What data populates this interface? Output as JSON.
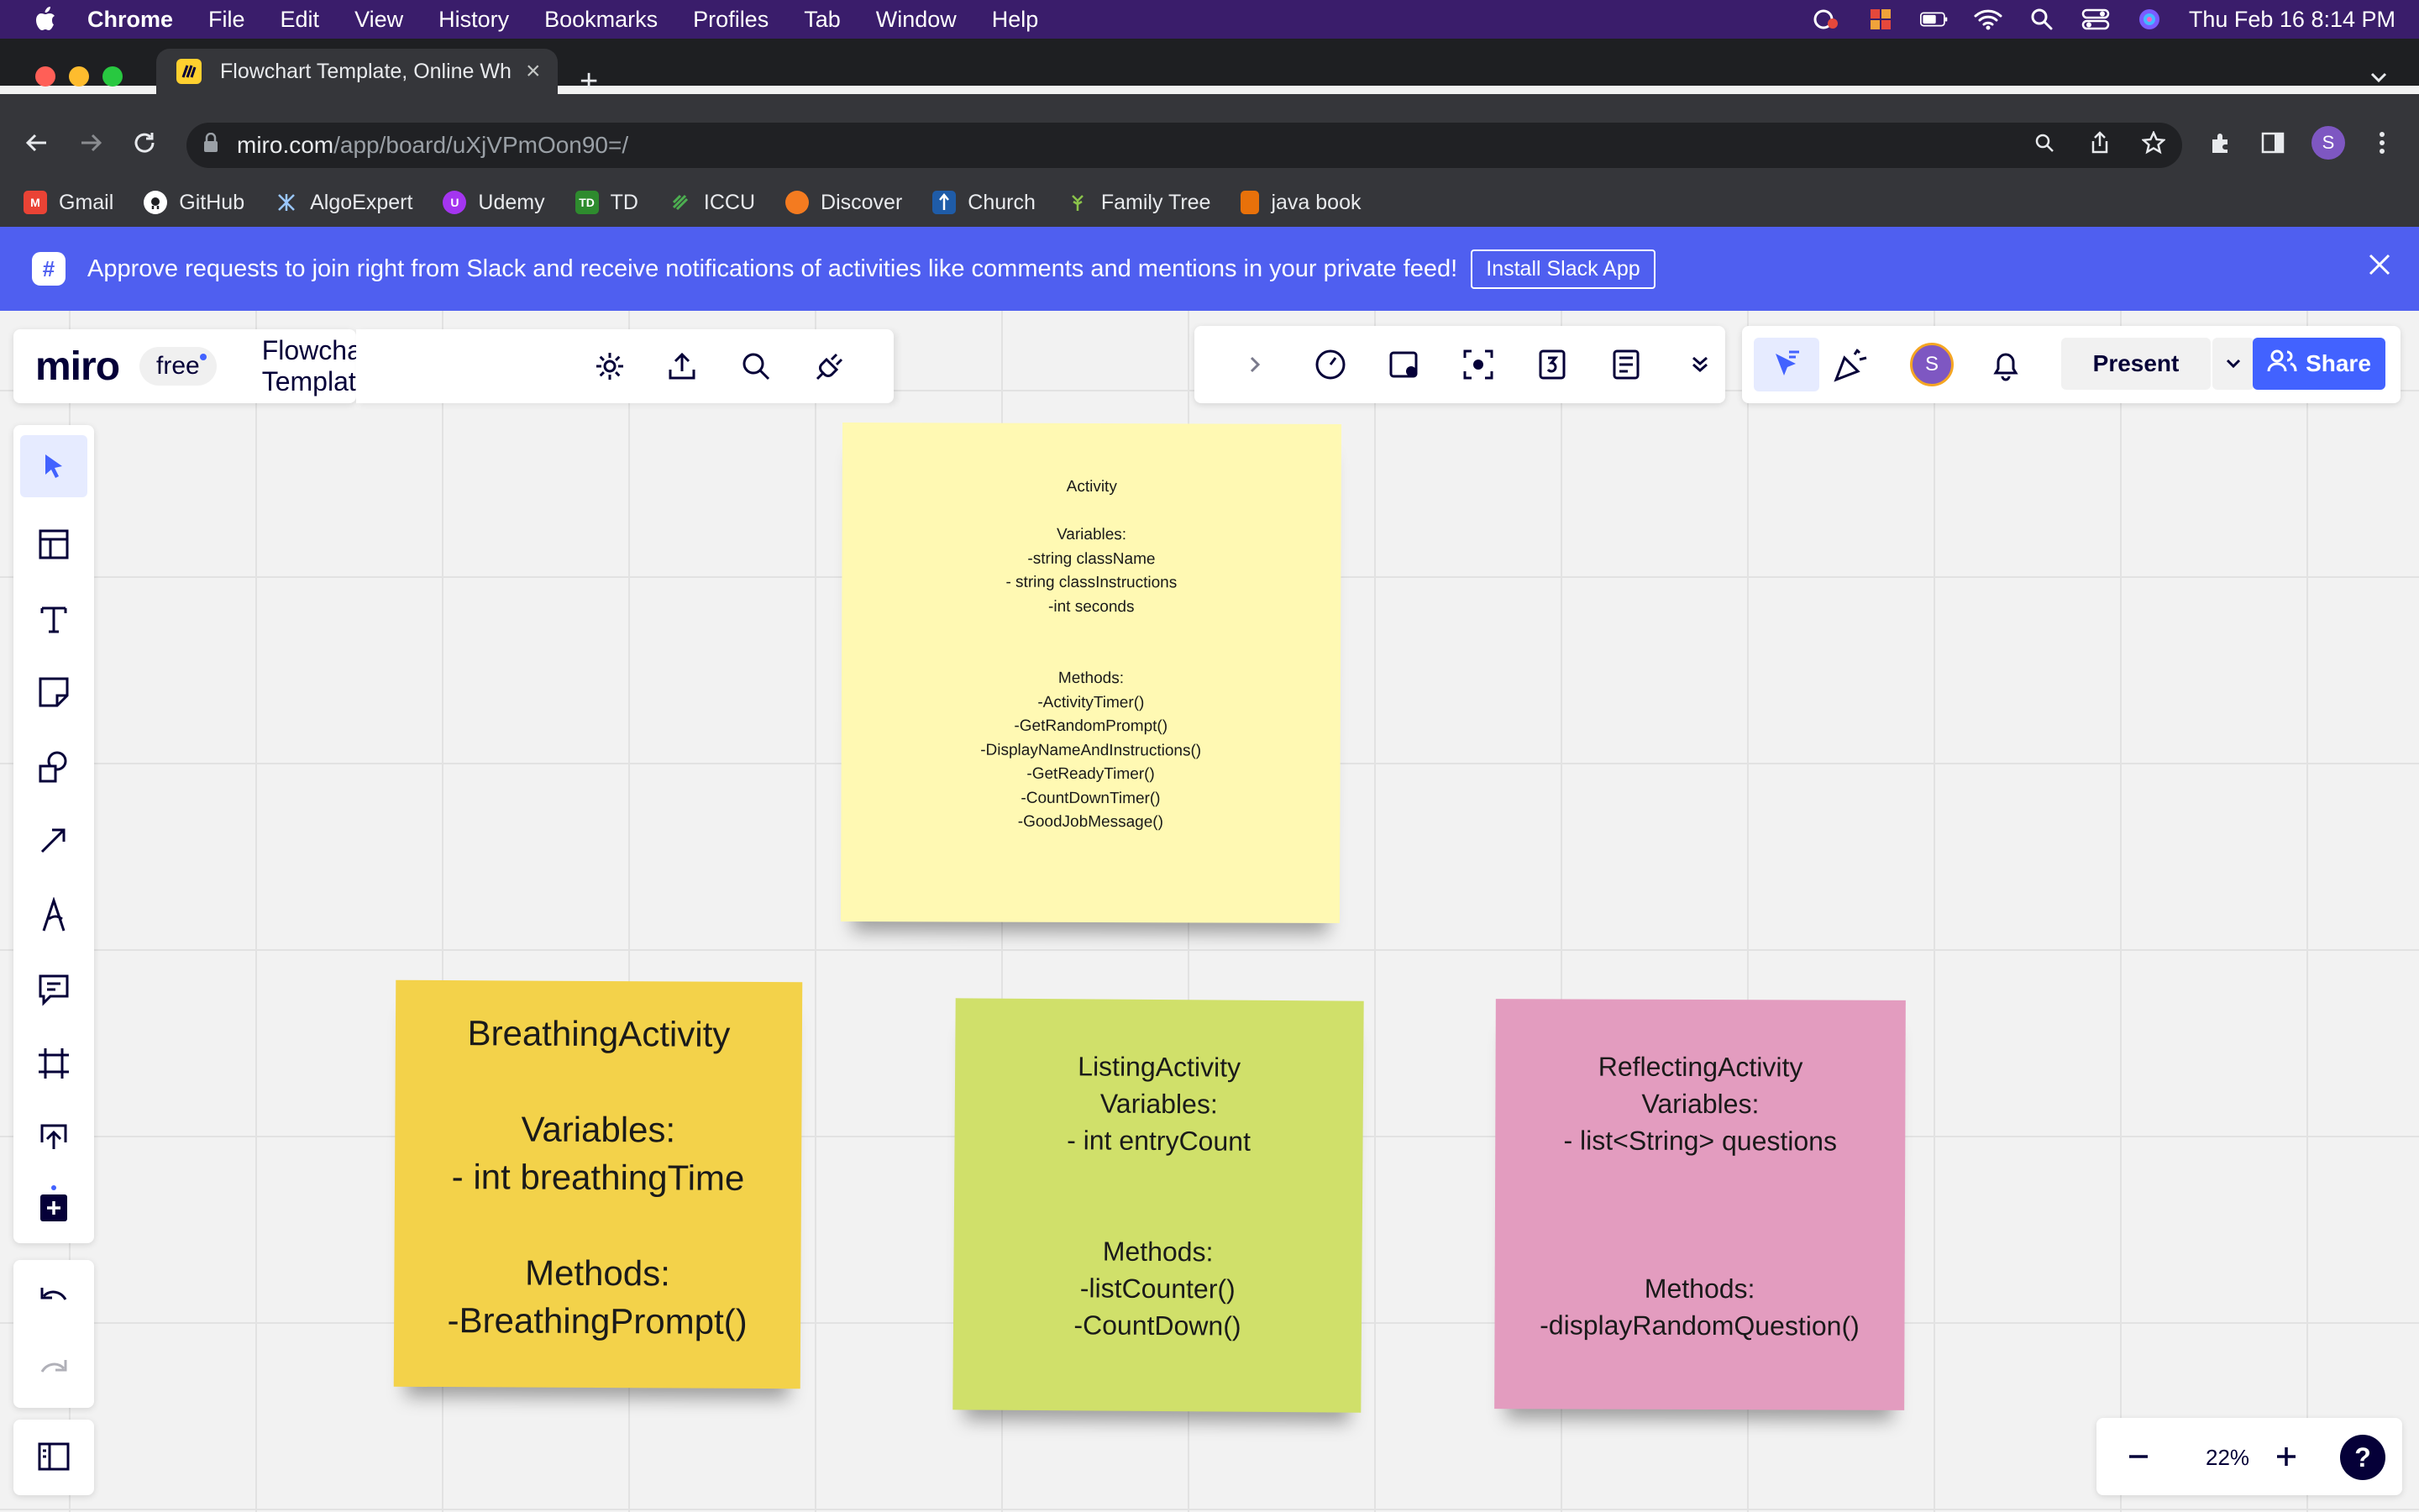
{
  "menubar": {
    "app": "Chrome",
    "items": [
      "File",
      "Edit",
      "View",
      "History",
      "Bookmarks",
      "Profiles",
      "Tab",
      "Window",
      "Help"
    ],
    "datetime": "Thu Feb 16  8:14 PM"
  },
  "browser": {
    "tab_title": "Flowchart Template, Online Wh",
    "url_host": "miro.com",
    "url_path": "/app/board/uXjVPmOon90=/",
    "profile_initial": "S"
  },
  "bookmarks": [
    {
      "label": "Gmail",
      "color": "#ea4335",
      "glyph": "M"
    },
    {
      "label": "GitHub",
      "color": "#ffffff",
      "glyph": ""
    },
    {
      "label": "AlgoExpert",
      "color": "#35363a",
      "glyph": ""
    },
    {
      "label": "Udemy",
      "color": "#a435f0",
      "glyph": "U"
    },
    {
      "label": "TD",
      "color": "#2e8b2e",
      "glyph": "TD"
    },
    {
      "label": "ICCU",
      "color": "#35363a",
      "glyph": ""
    },
    {
      "label": "Discover",
      "color": "#f47b20",
      "glyph": ""
    },
    {
      "label": "Church",
      "color": "#1f5ca8",
      "glyph": ""
    },
    {
      "label": "Family Tree",
      "color": "#35363a",
      "glyph": ""
    },
    {
      "label": "java book",
      "color": "#e8710a",
      "glyph": ""
    }
  ],
  "banner": {
    "text": "Approve requests to join right from Slack and receive notifications of activities like comments and mentions in your private feed!",
    "button": "Install Slack App"
  },
  "miro": {
    "logo": "miro",
    "plan": "free",
    "board_name": "Flowchart Template",
    "present_label": "Present",
    "share_label": "Share",
    "avatar_initial": "S",
    "zoom": "22%",
    "help": "?"
  },
  "notes": {
    "activity": "Activity\n\nVariables:\n-string className\n- string classInstructions\n-int seconds\n\n\nMethods:\n-ActivityTimer()\n-GetRandomPrompt()\n-DisplayNameAndInstructions()\n-GetReadyTimer()\n-CountDownTimer()\n-GoodJobMessage()",
    "breathing": "BreathingActivity\n\nVariables:\n- int breathingTime\n\nMethods:\n-BreathingPrompt()",
    "listing": "ListingActivity\nVariables:\n- int entryCount\n\n\nMethods:\n-listCounter()\n-CountDown()",
    "reflecting": "ReflectingActivity\nVariables:\n- list<String> questions\n\n\n\nMethods:\n-displayRandomQuestion()"
  },
  "colors": {
    "menubar": "#3a1d6b",
    "banner": "#4f5ff0",
    "miro_accent": "#4262ff",
    "note_activity": "#fff9b3",
    "note_breathing": "#f3d24a",
    "note_listing": "#d0e06a",
    "note_reflecting": "#e39cbf"
  }
}
